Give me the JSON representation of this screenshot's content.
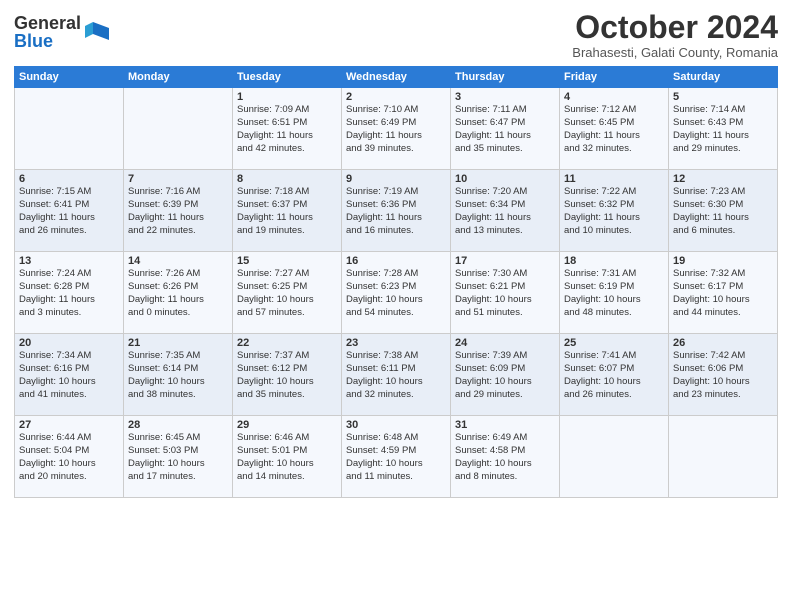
{
  "header": {
    "logo_general": "General",
    "logo_blue": "Blue",
    "month_title": "October 2024",
    "subtitle": "Brahasesti, Galati County, Romania"
  },
  "days_of_week": [
    "Sunday",
    "Monday",
    "Tuesday",
    "Wednesday",
    "Thursday",
    "Friday",
    "Saturday"
  ],
  "weeks": [
    [
      {
        "day": "",
        "lines": []
      },
      {
        "day": "",
        "lines": []
      },
      {
        "day": "1",
        "lines": [
          "Sunrise: 7:09 AM",
          "Sunset: 6:51 PM",
          "Daylight: 11 hours",
          "and 42 minutes."
        ]
      },
      {
        "day": "2",
        "lines": [
          "Sunrise: 7:10 AM",
          "Sunset: 6:49 PM",
          "Daylight: 11 hours",
          "and 39 minutes."
        ]
      },
      {
        "day": "3",
        "lines": [
          "Sunrise: 7:11 AM",
          "Sunset: 6:47 PM",
          "Daylight: 11 hours",
          "and 35 minutes."
        ]
      },
      {
        "day": "4",
        "lines": [
          "Sunrise: 7:12 AM",
          "Sunset: 6:45 PM",
          "Daylight: 11 hours",
          "and 32 minutes."
        ]
      },
      {
        "day": "5",
        "lines": [
          "Sunrise: 7:14 AM",
          "Sunset: 6:43 PM",
          "Daylight: 11 hours",
          "and 29 minutes."
        ]
      }
    ],
    [
      {
        "day": "6",
        "lines": [
          "Sunrise: 7:15 AM",
          "Sunset: 6:41 PM",
          "Daylight: 11 hours",
          "and 26 minutes."
        ]
      },
      {
        "day": "7",
        "lines": [
          "Sunrise: 7:16 AM",
          "Sunset: 6:39 PM",
          "Daylight: 11 hours",
          "and 22 minutes."
        ]
      },
      {
        "day": "8",
        "lines": [
          "Sunrise: 7:18 AM",
          "Sunset: 6:37 PM",
          "Daylight: 11 hours",
          "and 19 minutes."
        ]
      },
      {
        "day": "9",
        "lines": [
          "Sunrise: 7:19 AM",
          "Sunset: 6:36 PM",
          "Daylight: 11 hours",
          "and 16 minutes."
        ]
      },
      {
        "day": "10",
        "lines": [
          "Sunrise: 7:20 AM",
          "Sunset: 6:34 PM",
          "Daylight: 11 hours",
          "and 13 minutes."
        ]
      },
      {
        "day": "11",
        "lines": [
          "Sunrise: 7:22 AM",
          "Sunset: 6:32 PM",
          "Daylight: 11 hours",
          "and 10 minutes."
        ]
      },
      {
        "day": "12",
        "lines": [
          "Sunrise: 7:23 AM",
          "Sunset: 6:30 PM",
          "Daylight: 11 hours",
          "and 6 minutes."
        ]
      }
    ],
    [
      {
        "day": "13",
        "lines": [
          "Sunrise: 7:24 AM",
          "Sunset: 6:28 PM",
          "Daylight: 11 hours",
          "and 3 minutes."
        ]
      },
      {
        "day": "14",
        "lines": [
          "Sunrise: 7:26 AM",
          "Sunset: 6:26 PM",
          "Daylight: 11 hours",
          "and 0 minutes."
        ]
      },
      {
        "day": "15",
        "lines": [
          "Sunrise: 7:27 AM",
          "Sunset: 6:25 PM",
          "Daylight: 10 hours",
          "and 57 minutes."
        ]
      },
      {
        "day": "16",
        "lines": [
          "Sunrise: 7:28 AM",
          "Sunset: 6:23 PM",
          "Daylight: 10 hours",
          "and 54 minutes."
        ]
      },
      {
        "day": "17",
        "lines": [
          "Sunrise: 7:30 AM",
          "Sunset: 6:21 PM",
          "Daylight: 10 hours",
          "and 51 minutes."
        ]
      },
      {
        "day": "18",
        "lines": [
          "Sunrise: 7:31 AM",
          "Sunset: 6:19 PM",
          "Daylight: 10 hours",
          "and 48 minutes."
        ]
      },
      {
        "day": "19",
        "lines": [
          "Sunrise: 7:32 AM",
          "Sunset: 6:17 PM",
          "Daylight: 10 hours",
          "and 44 minutes."
        ]
      }
    ],
    [
      {
        "day": "20",
        "lines": [
          "Sunrise: 7:34 AM",
          "Sunset: 6:16 PM",
          "Daylight: 10 hours",
          "and 41 minutes."
        ]
      },
      {
        "day": "21",
        "lines": [
          "Sunrise: 7:35 AM",
          "Sunset: 6:14 PM",
          "Daylight: 10 hours",
          "and 38 minutes."
        ]
      },
      {
        "day": "22",
        "lines": [
          "Sunrise: 7:37 AM",
          "Sunset: 6:12 PM",
          "Daylight: 10 hours",
          "and 35 minutes."
        ]
      },
      {
        "day": "23",
        "lines": [
          "Sunrise: 7:38 AM",
          "Sunset: 6:11 PM",
          "Daylight: 10 hours",
          "and 32 minutes."
        ]
      },
      {
        "day": "24",
        "lines": [
          "Sunrise: 7:39 AM",
          "Sunset: 6:09 PM",
          "Daylight: 10 hours",
          "and 29 minutes."
        ]
      },
      {
        "day": "25",
        "lines": [
          "Sunrise: 7:41 AM",
          "Sunset: 6:07 PM",
          "Daylight: 10 hours",
          "and 26 minutes."
        ]
      },
      {
        "day": "26",
        "lines": [
          "Sunrise: 7:42 AM",
          "Sunset: 6:06 PM",
          "Daylight: 10 hours",
          "and 23 minutes."
        ]
      }
    ],
    [
      {
        "day": "27",
        "lines": [
          "Sunrise: 6:44 AM",
          "Sunset: 5:04 PM",
          "Daylight: 10 hours",
          "and 20 minutes."
        ]
      },
      {
        "day": "28",
        "lines": [
          "Sunrise: 6:45 AM",
          "Sunset: 5:03 PM",
          "Daylight: 10 hours",
          "and 17 minutes."
        ]
      },
      {
        "day": "29",
        "lines": [
          "Sunrise: 6:46 AM",
          "Sunset: 5:01 PM",
          "Daylight: 10 hours",
          "and 14 minutes."
        ]
      },
      {
        "day": "30",
        "lines": [
          "Sunrise: 6:48 AM",
          "Sunset: 4:59 PM",
          "Daylight: 10 hours",
          "and 11 minutes."
        ]
      },
      {
        "day": "31",
        "lines": [
          "Sunrise: 6:49 AM",
          "Sunset: 4:58 PM",
          "Daylight: 10 hours",
          "and 8 minutes."
        ]
      },
      {
        "day": "",
        "lines": []
      },
      {
        "day": "",
        "lines": []
      }
    ]
  ]
}
